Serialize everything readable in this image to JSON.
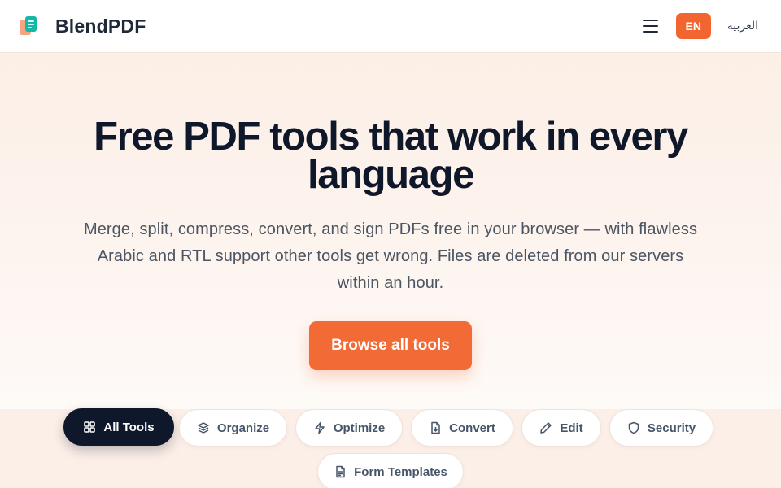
{
  "header": {
    "brand": "BlendPDF",
    "lang_en": "EN",
    "lang_ar": "العربية"
  },
  "hero": {
    "title": "Free PDF tools that work in every language",
    "subtitle": "Merge, split, compress, convert, and sign PDFs free in your browser — with flawless Arabic and RTL support other tools get wrong. Files are deleted from our servers within an hour.",
    "cta": "Browse all tools"
  },
  "categories": [
    {
      "label": "All Tools",
      "icon": "grid-icon",
      "active": true
    },
    {
      "label": "Organize",
      "icon": "layers-icon",
      "active": false
    },
    {
      "label": "Optimize",
      "icon": "lightning-icon",
      "active": false
    },
    {
      "label": "Convert",
      "icon": "file-convert-icon",
      "active": false
    },
    {
      "label": "Edit",
      "icon": "pencil-icon",
      "active": false
    },
    {
      "label": "Security",
      "icon": "shield-icon",
      "active": false
    },
    {
      "label": "Form Templates",
      "icon": "document-icon",
      "active": false
    }
  ],
  "colors": {
    "accent": "#f26a35",
    "dark": "#0f172a",
    "logo_teal": "#14b8a6",
    "logo_peach": "#f4a582"
  }
}
